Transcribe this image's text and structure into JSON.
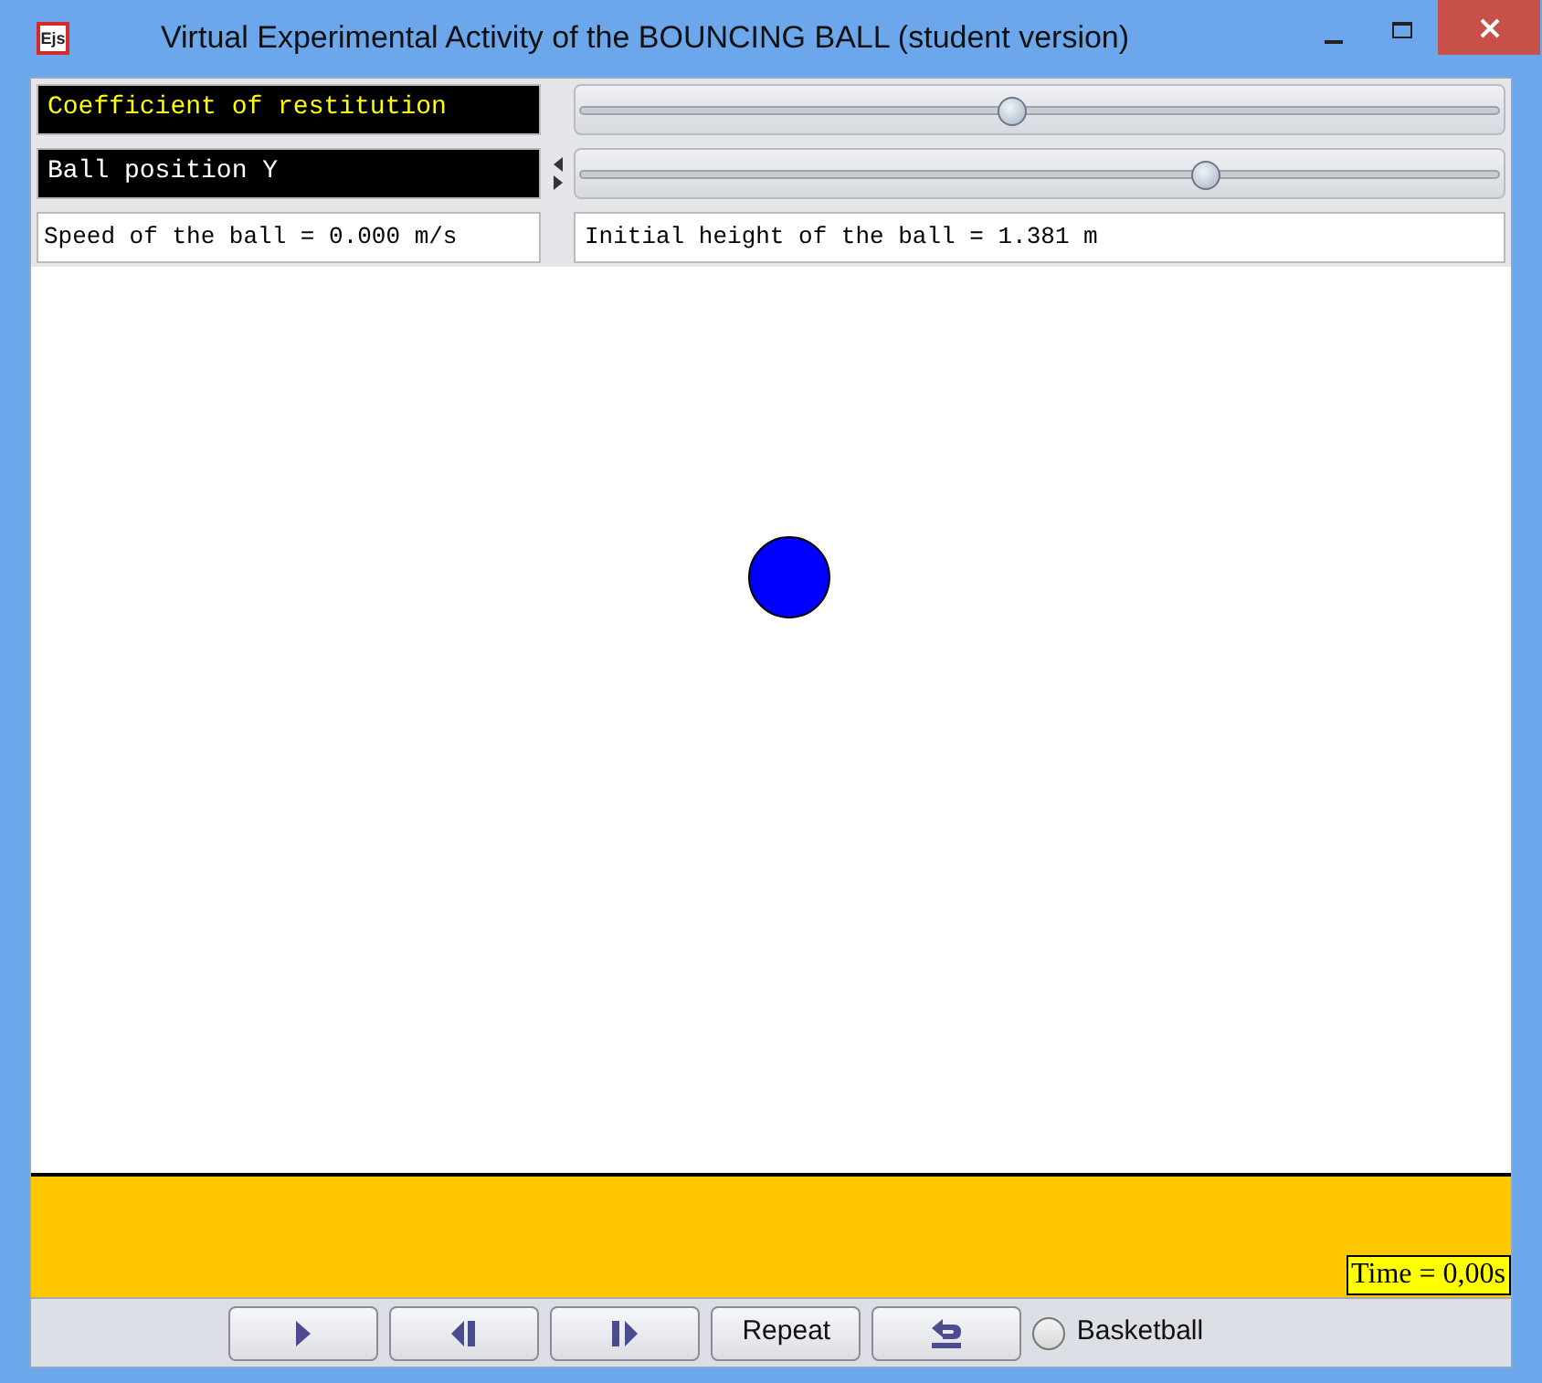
{
  "window": {
    "title": "Virtual Experimental Activity of the BOUNCING BALL (student version)",
    "app_icon": "Ejs"
  },
  "controls": [
    {
      "label": "Coefficient of restitution",
      "color": "#ffff00",
      "level": 0.47
    },
    {
      "label": "Ball position Y",
      "color": "#ffffff",
      "level": 0.68
    }
  ],
  "readouts": [
    "Speed of the ball = 0.000 m/s",
    "Initial height of the ball = 1.381 m"
  ],
  "time_label": "Time = 0,00s",
  "toolbar": [
    {
      "kind": "play"
    },
    {
      "kind": "step_back"
    },
    {
      "kind": "step_forward"
    },
    {
      "kind": "text",
      "label": "Repeat"
    },
    {
      "kind": "reset"
    }
  ],
  "basketball": {
    "label": "Basketball",
    "selected": false
  }
}
